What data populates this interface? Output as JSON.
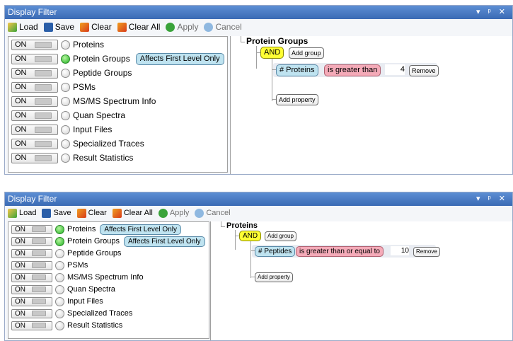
{
  "colors": {
    "titlebar": "#3a6ab4",
    "green_status": "#1fb11f",
    "and_yellow": "#ffff33",
    "property_blue": "#bfe3f0",
    "operator_pink": "#f4aab8"
  },
  "panels": [
    {
      "title": "Display Filter",
      "title_controls": "▾ ᵖ ✕",
      "toolbar": {
        "load": "Load",
        "save": "Save",
        "clear": "Clear",
        "clear_all": "Clear All",
        "apply": "Apply",
        "cancel": "Cancel"
      },
      "items": [
        {
          "toggle": "ON",
          "label": "Proteins",
          "status": "gray"
        },
        {
          "toggle": "ON",
          "label": "Protein Groups",
          "status": "green",
          "chip": "Affects First Level Only"
        },
        {
          "toggle": "ON",
          "label": "Peptide Groups",
          "status": "gray"
        },
        {
          "toggle": "ON",
          "label": "PSMs",
          "status": "gray"
        },
        {
          "toggle": "ON",
          "label": "MS/MS Spectrum Info",
          "status": "gray"
        },
        {
          "toggle": "ON",
          "label": "Quan Spectra",
          "status": "gray"
        },
        {
          "toggle": "ON",
          "label": "Input Files",
          "status": "gray"
        },
        {
          "toggle": "ON",
          "label": "Specialized Traces",
          "status": "gray"
        },
        {
          "toggle": "ON",
          "label": "Result Statistics",
          "status": "gray"
        }
      ],
      "editor": {
        "group_title": "Protein Groups",
        "and": "AND",
        "add_group": "Add group",
        "property": "# Proteins",
        "operator": "is greater than",
        "value": "4",
        "remove": "Remove",
        "add_property": "Add property"
      }
    },
    {
      "title": "Display Filter",
      "title_controls": "▾ ᵖ ✕",
      "toolbar": {
        "load": "Load",
        "save": "Save",
        "clear": "Clear",
        "clear_all": "Clear All",
        "apply": "Apply",
        "cancel": "Cancel"
      },
      "items": [
        {
          "toggle": "ON",
          "label": "Proteins",
          "status": "green",
          "chip": "Affects First Level Only"
        },
        {
          "toggle": "ON",
          "label": "Protein Groups",
          "status": "green",
          "chip": "Affects First Level Only"
        },
        {
          "toggle": "ON",
          "label": "Peptide Groups",
          "status": "gray"
        },
        {
          "toggle": "ON",
          "label": "PSMs",
          "status": "gray"
        },
        {
          "toggle": "ON",
          "label": "MS/MS Spectrum Info",
          "status": "gray"
        },
        {
          "toggle": "ON",
          "label": "Quan Spectra",
          "status": "gray"
        },
        {
          "toggle": "ON",
          "label": "Input Files",
          "status": "gray"
        },
        {
          "toggle": "ON",
          "label": "Specialized Traces",
          "status": "gray"
        },
        {
          "toggle": "ON",
          "label": "Result Statistics",
          "status": "gray"
        }
      ],
      "editor": {
        "group_title": "Proteins",
        "and": "AND",
        "add_group": "Add group",
        "property": "# Peptides",
        "operator": "is greater than or equal to",
        "value": "10",
        "remove": "Remove",
        "add_property": "Add property"
      }
    }
  ]
}
